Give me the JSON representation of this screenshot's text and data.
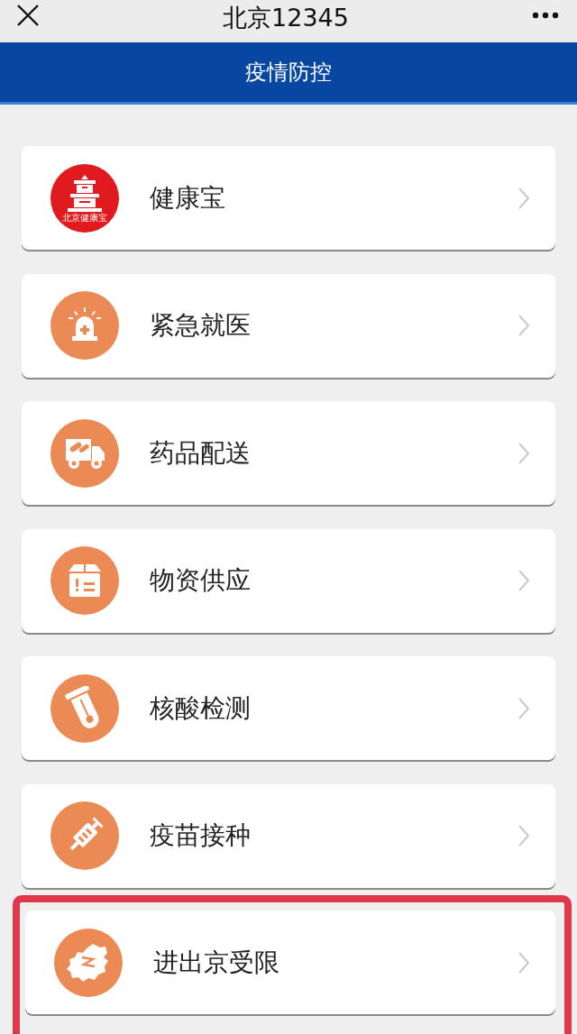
{
  "top_bar": {
    "title": "北京12345"
  },
  "header": {
    "title": "疫情防控"
  },
  "items": [
    {
      "label": "健康宝",
      "kind": "logo",
      "logo_caption": "北京健康宝",
      "highlighted": false
    },
    {
      "label": "紧急就医",
      "kind": "siren",
      "highlighted": false
    },
    {
      "label": "药品配送",
      "kind": "truck",
      "highlighted": false
    },
    {
      "label": "物资供应",
      "kind": "box",
      "highlighted": false
    },
    {
      "label": "核酸检测",
      "kind": "tube",
      "highlighted": false
    },
    {
      "label": "疫苗接种",
      "kind": "syringe",
      "highlighted": false
    },
    {
      "label": "进出京受限",
      "kind": "map",
      "highlighted": true
    }
  ]
}
